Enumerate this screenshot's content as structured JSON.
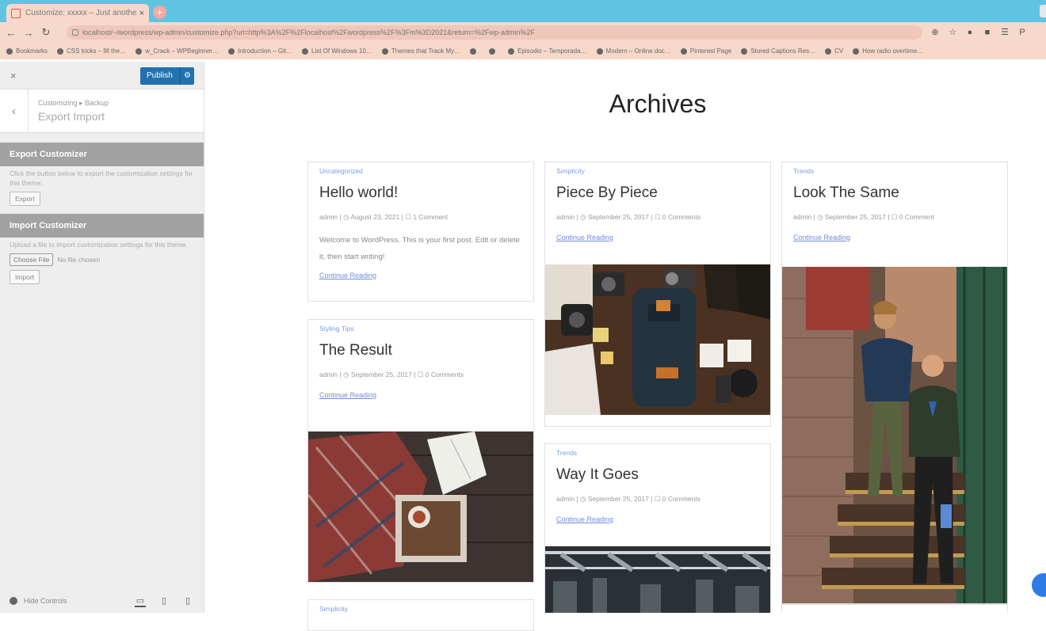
{
  "browser": {
    "tab_title": "Customize: xxxxx – Just another…",
    "tab_close": "×",
    "new_tab": "+",
    "url": "localhost/~/wordpress/wp-admin/customize.php?url=http%3A%2F%2Flocalhost%2Fwordpress%2F%3Fm%3D2021&return=%2Fwp-admin%2F",
    "bookmarks": [
      "Bookmarks",
      "CSS tricks – fill the…",
      "w_Crack – WPBeginner…",
      "Introduction – Git…",
      "List Of Windows 10…",
      "Themes that Track My…",
      "",
      "",
      "Episodio – Temporada…",
      "Modern – Online doc…",
      "Pinterest Page",
      "Stored Captions Res…",
      "CV",
      "How radio overtime…"
    ]
  },
  "sidebar": {
    "close_label": "×",
    "publish_label": "Publish",
    "publish_gear": "⚙",
    "breadcrumb": "Customizing ▸ Backup",
    "section_title": "Export Import",
    "back_label": "‹",
    "export": {
      "heading": "Export Customizer",
      "description": "Click the button below to export the customization settings for this theme.",
      "button": "Export"
    },
    "import": {
      "heading": "Import Customizer",
      "description": "Upload a file to import customization settings for this theme.",
      "choose_file": "Choose File",
      "no_file": "No file chosen",
      "button": "Import"
    },
    "footer": {
      "hide_controls": "Hide Controls",
      "devices": [
        "desktop-icon",
        "tablet-icon",
        "mobile-icon"
      ]
    }
  },
  "preview": {
    "archive_title": "Archives",
    "posts": [
      {
        "category": "Uncategorized",
        "title": "Hello world!",
        "meta": "admin | ◷ August 23, 2021 | ☐ 1 Comment",
        "excerpt": "Welcome to WordPress. This is your first post. Edit or delete it, then start writing!",
        "more": "Continue Reading"
      },
      {
        "category": "Simplicity",
        "title": "Piece By Piece",
        "meta": "admin | ◷ September 25, 2017 | ☐ 0 Comments",
        "excerpt": "",
        "more": "Continue Reading"
      },
      {
        "category": "Trends",
        "title": "Look The Same",
        "meta": "admin | ◷ September 25, 2017 | ☐ 0 Comment",
        "excerpt": "",
        "more": "Continue Reading"
      },
      {
        "category": "Styling Tips",
        "title": "The Result",
        "meta": "admin | ◷ September 25, 2017 | ☐ 0 Comments",
        "excerpt": "",
        "more": "Continue Reading"
      },
      {
        "category": "Trends",
        "title": "Way It Goes",
        "meta": "admin | ◷ September 25, 2017 | ☐ 0 Comments",
        "excerpt": "",
        "more": "Continue Reading"
      },
      {
        "category": "Simplicity",
        "title": "",
        "meta": "",
        "excerpt": "",
        "more": ""
      }
    ]
  }
}
